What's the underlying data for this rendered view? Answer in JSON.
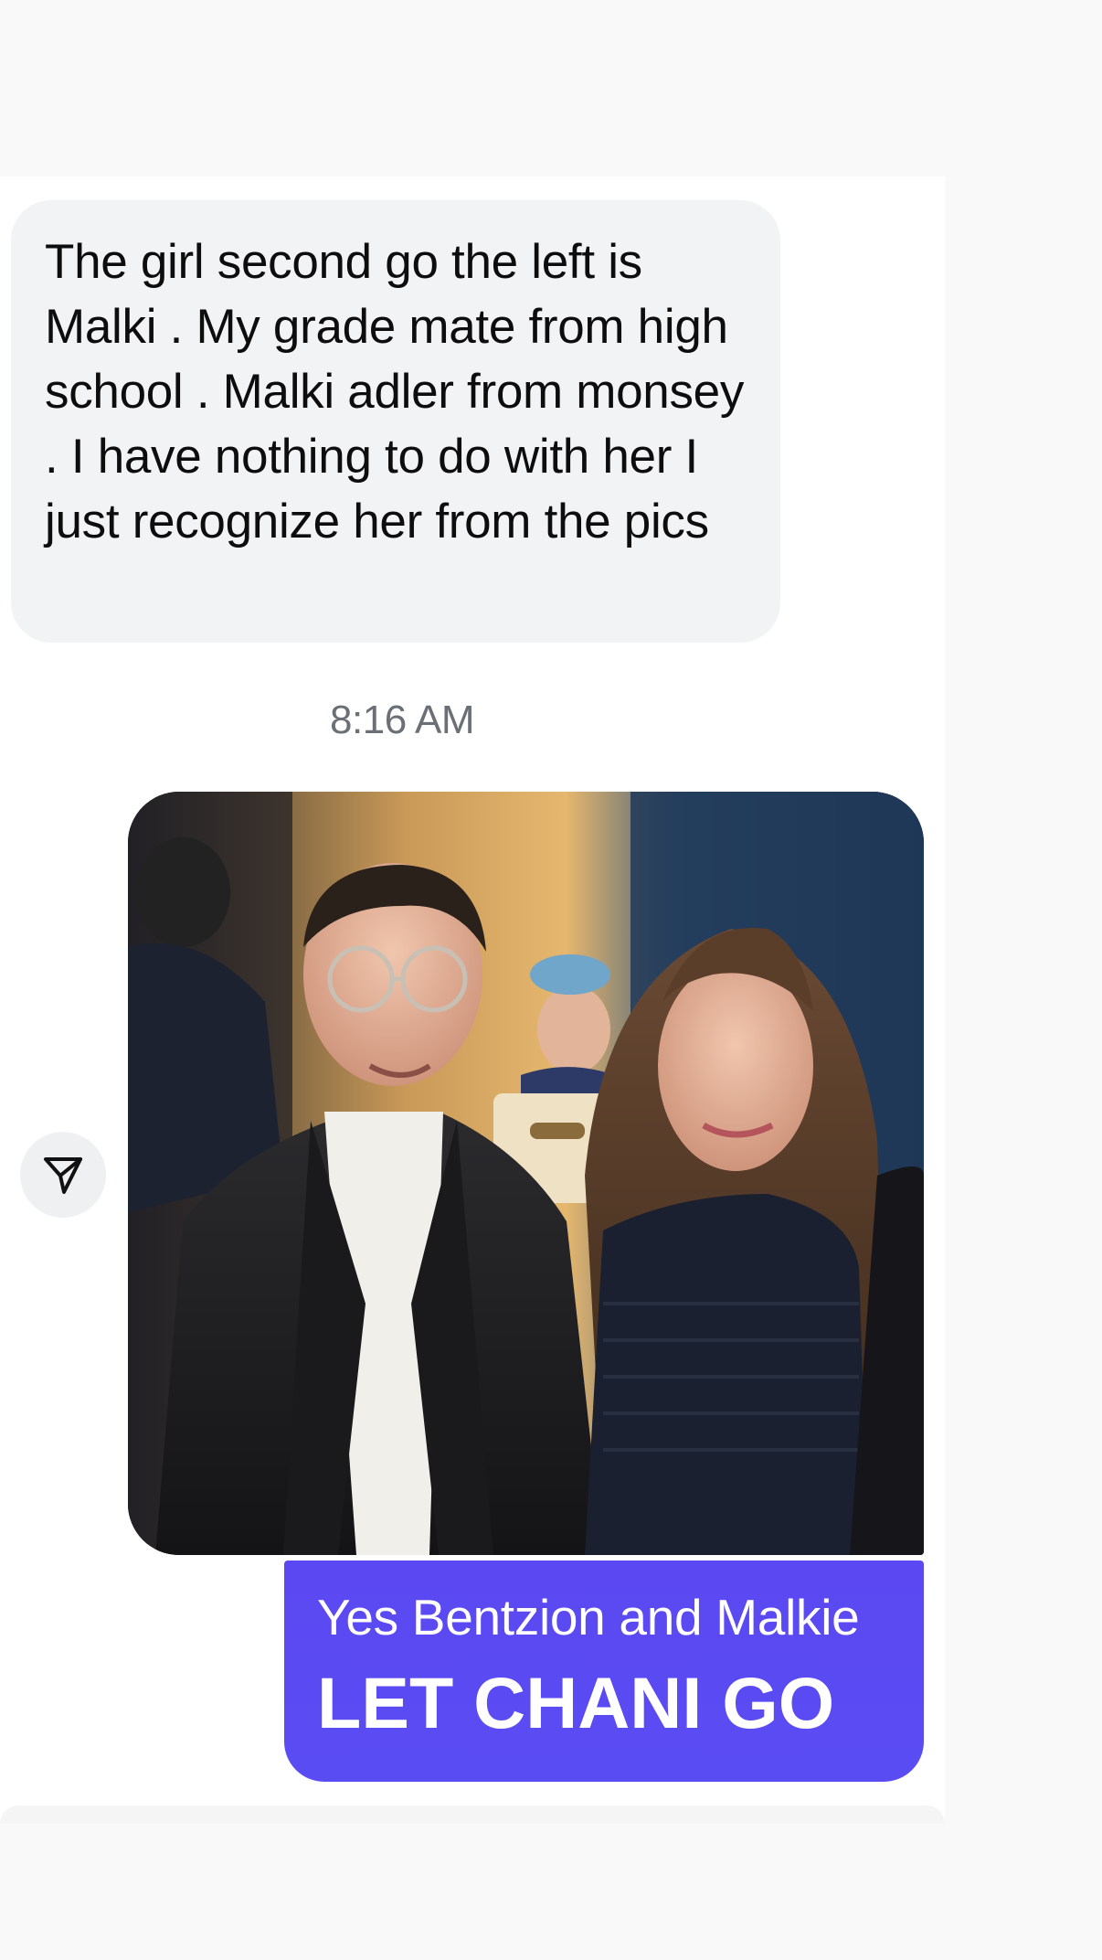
{
  "incoming_message": {
    "text": "The girl second go the left is Malki . My grade mate from high school . Malki adler from monsey . I have nothing to do with her I just recognize her from the pics"
  },
  "timestamp": "8:16 AM",
  "outgoing_photo": {
    "icon": "photo-icon"
  },
  "share_button": {
    "icon": "send-arrow-icon"
  },
  "outgoing_message": {
    "text": "Yes Bentzion and Malkie",
    "caption": "LET CHANI GO"
  },
  "colors": {
    "incoming_bubble": "#f2f3f5",
    "outgoing_bubble": "#5b48f2",
    "timestamp": "#6b6f76",
    "background": "#f9f9f9"
  }
}
